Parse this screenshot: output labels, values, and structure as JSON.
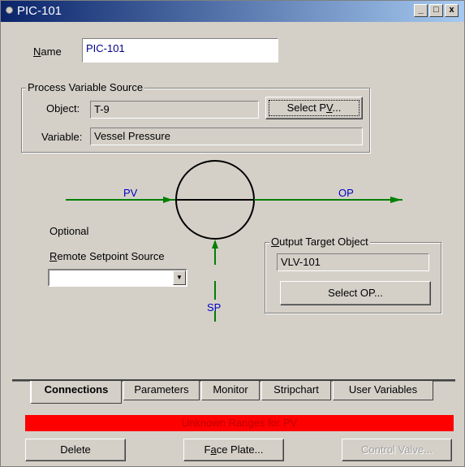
{
  "window": {
    "title": "PIC-101",
    "minimize": "_",
    "maximize": "□",
    "close": "x"
  },
  "name_field": {
    "label_mnemonic": "N",
    "label_rest": "ame",
    "value": "PIC-101"
  },
  "pv_source": {
    "group_title": "Process Variable Source",
    "object_label": "Object:",
    "object_value": "T-9",
    "variable_label": "Variable:",
    "variable_value": "Vessel Pressure",
    "select_pv_pre": "Select P",
    "select_pv_mnemonic": "V",
    "select_pv_post": "..."
  },
  "diagram": {
    "pv_label": "PV",
    "op_label": "OP",
    "sp_label": "SP",
    "line_color": "#008000",
    "label_color": "#0000c0"
  },
  "remote_setpoint": {
    "optional_label": "Optional",
    "label_mnemonic": "R",
    "label_rest": "emote Setpoint Source",
    "value": ""
  },
  "output_target": {
    "group_title_mnemonic": "O",
    "group_title_rest": "utput Target Object",
    "value": "VLV-101",
    "select_op_label": "Select OP..."
  },
  "tabs": [
    {
      "label": "Connections",
      "active": true
    },
    {
      "label": "Parameters",
      "active": false
    },
    {
      "label": "Monitor",
      "active": false
    },
    {
      "label": "Stripchart",
      "active": false
    },
    {
      "label": "User Variables",
      "active": false
    }
  ],
  "status": {
    "message": "Unknown Ranges for PV",
    "background": "#ff0000"
  },
  "buttons": {
    "delete": "Delete",
    "face_plate_pre": "F",
    "face_plate_mnemonic": "a",
    "face_plate_post": "ce Plate...",
    "control_valve": "Control Valve..."
  }
}
